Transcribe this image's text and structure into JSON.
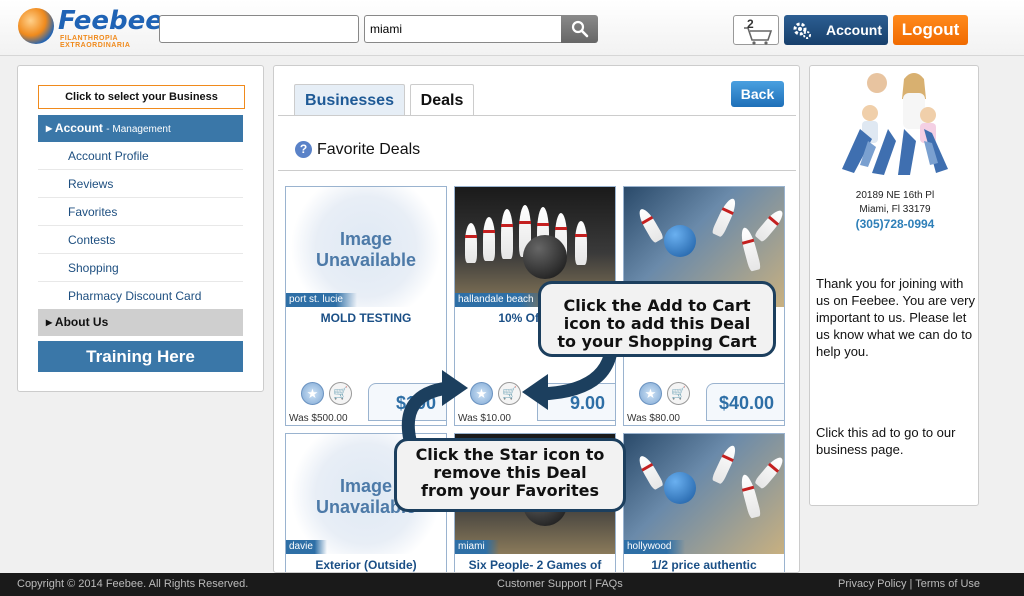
{
  "header": {
    "logo_name": "Feebee",
    "logo_tagline_1": "FILANTHROPIA",
    "logo_tagline_2": "EXTRAORDINARIA",
    "search_primary_value": "",
    "search_location_value": "miami",
    "cart_count": "2",
    "account_label": "Account",
    "logout_label": "Logout"
  },
  "sidebar": {
    "select_business_label": "Click to select your Business",
    "account_section": {
      "title": "Account",
      "subtitle": "- Management"
    },
    "items": [
      {
        "label": "Account Profile"
      },
      {
        "label": "Reviews"
      },
      {
        "label": "Favorites"
      },
      {
        "label": "Contests"
      },
      {
        "label": "Shopping"
      },
      {
        "label": "Pharmacy Discount Card"
      }
    ],
    "about_section": {
      "title": "About Us"
    },
    "training_label": "Training Here"
  },
  "main": {
    "tabs": [
      {
        "label": "Businesses"
      },
      {
        "label": "Deals"
      }
    ],
    "active_tab": "Deals",
    "back_label": "Back",
    "help_glyph": "?",
    "section_title": "Favorite Deals",
    "image_unavailable_text": [
      "Image",
      "Unavailable"
    ],
    "deals": [
      {
        "location": "port st. lucie",
        "title": "MOLD TESTING",
        "price": "$100",
        "was": "Was $500.00",
        "image": "unavailable"
      },
      {
        "location": "hallandale beach",
        "title": "10% Off Bow",
        "price": "9.00",
        "was": "Was $10.00",
        "image": "bowling-pins"
      },
      {
        "location": "",
        "title": "",
        "price": "$40.00",
        "was": "Was $80.00",
        "image": "bowling-strike"
      },
      {
        "location": "davie",
        "title": "Exterior (Outside)",
        "price": "",
        "was": "",
        "image": "unavailable"
      },
      {
        "location": "miami",
        "title": "Six People- 2 Games of",
        "price": "",
        "was": "",
        "image": "bowling-pins"
      },
      {
        "location": "hollywood",
        "title": "1/2 price authentic",
        "price": "",
        "was": "",
        "image": "bowling-strike"
      }
    ],
    "icons": {
      "favorite": "star-icon",
      "cart": "add-to-cart-icon"
    }
  },
  "callouts": {
    "cart": [
      "Click the Add to Cart",
      "icon to add this Deal",
      "to your Shopping Cart"
    ],
    "star": [
      "Click the Star icon to",
      "remove this Deal",
      "from your Favorites"
    ]
  },
  "right_panel": {
    "address_line_1": "20189 NE 16th Pl",
    "address_line_2": "Miami, Fl 33179",
    "phone": "(305)728-0994",
    "thanks_text": "Thank you for joining with us on Feebee. You are very important to us. Please let us know what we can do to help you.",
    "ad_text": "Click this ad to go to our business page."
  },
  "footer": {
    "copyright": "Copyright © 2014 Feebee. All Rights Reserved.",
    "support_links": "Customer Support | FAQs",
    "legal_links": "Privacy Policy | Terms of Use"
  },
  "colors": {
    "brand_blue": "#1f63b5",
    "brand_orange": "#f08a1c",
    "menu_blue": "#3a77a8",
    "footer_bg": "#1a1a1a"
  }
}
